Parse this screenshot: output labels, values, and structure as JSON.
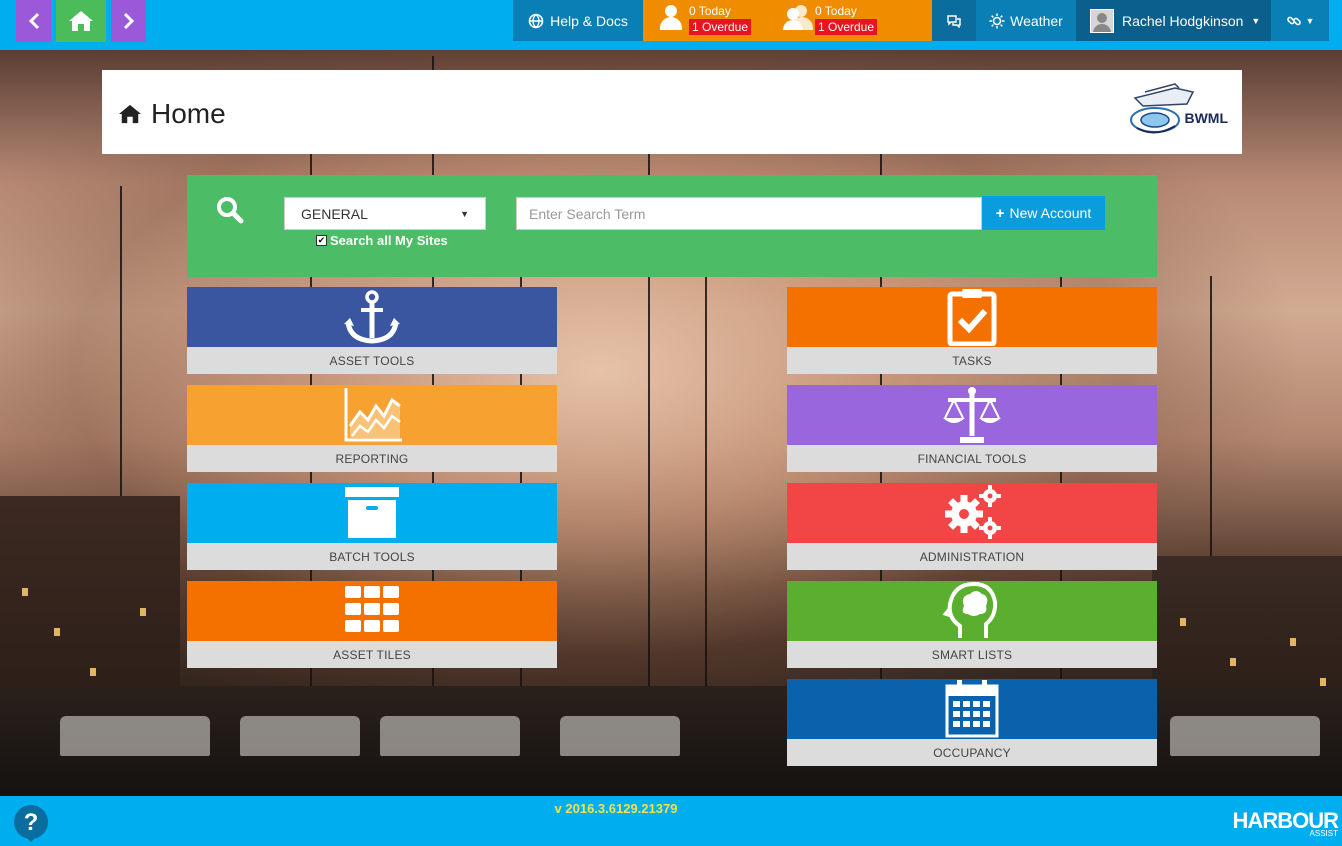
{
  "topbar": {
    "back_icon": "chevron-left-icon",
    "home_icon": "home-icon",
    "forward_icon": "chevron-right-icon",
    "help_label": "Help & Docs",
    "my_tasks": {
      "today": "0 Today",
      "overdue": "1 Overdue"
    },
    "team_tasks": {
      "today": "0 Today",
      "overdue": "1 Overdue"
    },
    "weather_label": "Weather",
    "user_name": "Rachel Hodgkinson"
  },
  "header": {
    "title": "Home",
    "logo_text": "BWML"
  },
  "search": {
    "select_value": "GENERAL",
    "checkbox_label": "Search all My Sites",
    "checkbox_checked": true,
    "input_placeholder": "Enter Search Term",
    "new_account_label": "New Account"
  },
  "tiles_left": [
    {
      "label": "ASSET TOOLS",
      "color": "#3b56a0",
      "icon": "anchor-icon"
    },
    {
      "label": "REPORTING",
      "color": "#f7a230",
      "icon": "chart-icon"
    },
    {
      "label": "BATCH TOOLS",
      "color": "#00aeef",
      "icon": "archive-box-icon"
    },
    {
      "label": "ASSET TILES",
      "color": "#f47100",
      "icon": "grid-icon"
    }
  ],
  "tiles_right": [
    {
      "label": "TASKS",
      "color": "#f47100",
      "icon": "clipboard-check-icon"
    },
    {
      "label": "FINANCIAL TOOLS",
      "color": "#9966dd",
      "icon": "scales-icon"
    },
    {
      "label": "ADMINISTRATION",
      "color": "#f24646",
      "icon": "gears-icon"
    },
    {
      "label": "SMART LISTS",
      "color": "#5ab02e",
      "icon": "head-brain-icon"
    },
    {
      "label": "OCCUPANCY",
      "color": "#0a62ad",
      "icon": "calendar-icon"
    }
  ],
  "footer": {
    "version": "v 2016.3.6129.21379",
    "brand": "HARBOUR",
    "brand_sub": "ASSIST"
  }
}
